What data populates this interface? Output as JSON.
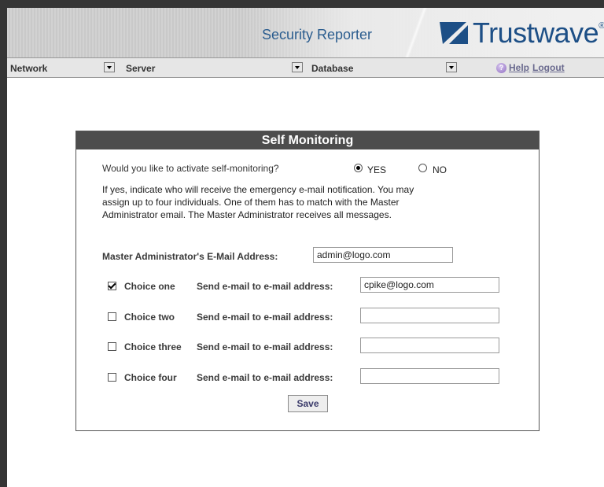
{
  "header": {
    "product_title": "Security Reporter",
    "brand_name": "Trustwave",
    "brand_reg": "®"
  },
  "nav": {
    "network": "Network",
    "server": "Server",
    "database": "Database",
    "help": "Help",
    "logout": "Logout"
  },
  "panel": {
    "title": "Self Monitoring",
    "question": "Would you like to activate self-monitoring?",
    "yes_label": "YES",
    "no_label": "NO",
    "selected": "YES",
    "info_lines": [
      "If yes, indicate who will receive the emergency e-mail notification. You may",
      "assign up to four individuals. One of them has to match with the Master",
      "Administrator email. The Master Administrator receives all messages."
    ],
    "master_label": "Master Administrator's E-Mail Address:",
    "master_value": "admin@logo.com",
    "send_label": "Send e-mail to e-mail address:",
    "choices": [
      {
        "label": "Choice one",
        "checked": true,
        "value": "cpike@logo.com"
      },
      {
        "label": "Choice two",
        "checked": false,
        "value": ""
      },
      {
        "label": "Choice three",
        "checked": false,
        "value": ""
      },
      {
        "label": "Choice four",
        "checked": false,
        "value": ""
      }
    ],
    "save_label": "Save"
  },
  "colors": {
    "brand_blue": "#1d4f86",
    "title_bar": "#4d4d4d",
    "link": "#6b6b8f"
  },
  "icons": {
    "brand_logo": "trustwave-logo-icon",
    "help": "help-icon",
    "dropdown": "chevron-down-icon"
  }
}
